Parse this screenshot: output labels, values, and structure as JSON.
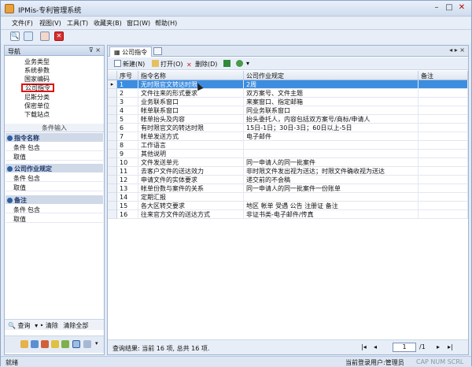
{
  "window": {
    "title": "IPMis-专利管理系统"
  },
  "menu": [
    "文件(F)",
    "视图(V)",
    "工具(T)",
    "收藏夹(B)",
    "窗口(W)",
    "帮助(H)"
  ],
  "sidebar": {
    "header": "导航",
    "pin": "⊽ ×",
    "nav_items": [
      "业务类型",
      "系统参数",
      "国家编码",
      "公司指令",
      "尼斯分类",
      "保密单位",
      "下载站点"
    ],
    "selected_index": 3,
    "condition_title": "条件输入",
    "groups": [
      {
        "title": "指令名称",
        "rows": [
          {
            "k": "条件",
            "v": "包含"
          },
          {
            "k": "取值",
            "v": ""
          }
        ]
      },
      {
        "title": "公司作业规定",
        "rows": [
          {
            "k": "条件",
            "v": "包含"
          },
          {
            "k": "取值",
            "v": ""
          }
        ]
      },
      {
        "title": "备注",
        "rows": [
          {
            "k": "条件",
            "v": "包含"
          },
          {
            "k": "取值",
            "v": ""
          }
        ]
      }
    ],
    "query_label": "查询",
    "clear_label": "清除",
    "clear_all_label": "清除全部"
  },
  "main": {
    "tab_label": "公司指令",
    "tab_nav": "◂ ▸ ×",
    "toolbar": {
      "new": "新建(N)",
      "open": "打开(O)",
      "delete": "删除(D)"
    },
    "columns": [
      "序号",
      "指令名称",
      "公司作业规定",
      "备注"
    ],
    "rows": [
      [
        "1",
        "无时限官文转达时限",
        "2周",
        ""
      ],
      [
        "2",
        "文件往来的形式要求",
        "双方案号、文件主题",
        ""
      ],
      [
        "3",
        "业务联系窗口",
        "来案窗口、指定邮箱",
        ""
      ],
      [
        "4",
        "帐单联系窗口",
        "同业务联系窗口",
        ""
      ],
      [
        "5",
        "帐单抬头及内容",
        "抬头委托人，内容包括双方案号/商标/申请人",
        ""
      ],
      [
        "6",
        "有时限官文的转达时限",
        "15日-1日；30日-3日；60日以上-5日",
        ""
      ],
      [
        "7",
        "帐单发送方式",
        "电子邮件",
        ""
      ],
      [
        "8",
        "工作语言",
        "",
        ""
      ],
      [
        "9",
        "其他说明",
        "",
        ""
      ],
      [
        "10",
        "文件发送单元",
        "同一申请人的同一批案件",
        ""
      ],
      [
        "11",
        "去客户文件的送达效力",
        "非时限文件发出视为送达；时限文件确收视为送达",
        ""
      ],
      [
        "12",
        "申请文件的实体要求",
        "递交前的不会稿",
        ""
      ],
      [
        "13",
        "帐单份数与案件的关系",
        "同一申请人的同一批案件一份账单",
        ""
      ],
      [
        "14",
        "定期汇报",
        "",
        ""
      ],
      [
        "15",
        "各大区转交要求",
        "地区        帐单        受遇        公告        注册证        备注",
        ""
      ],
      [
        "16",
        "往来官方文件的送达方式",
        "非证书类-电子邮件/传真",
        ""
      ]
    ],
    "selected_row": 0,
    "footer": {
      "result": "查询结果: 当前 16 项, 总共 16 项.",
      "page": "1",
      "total_pages": "/1"
    }
  },
  "status": {
    "left": "就绪",
    "user": "当前登录用户:管理员",
    "indicators": "CAP   NUM   SCRL"
  }
}
